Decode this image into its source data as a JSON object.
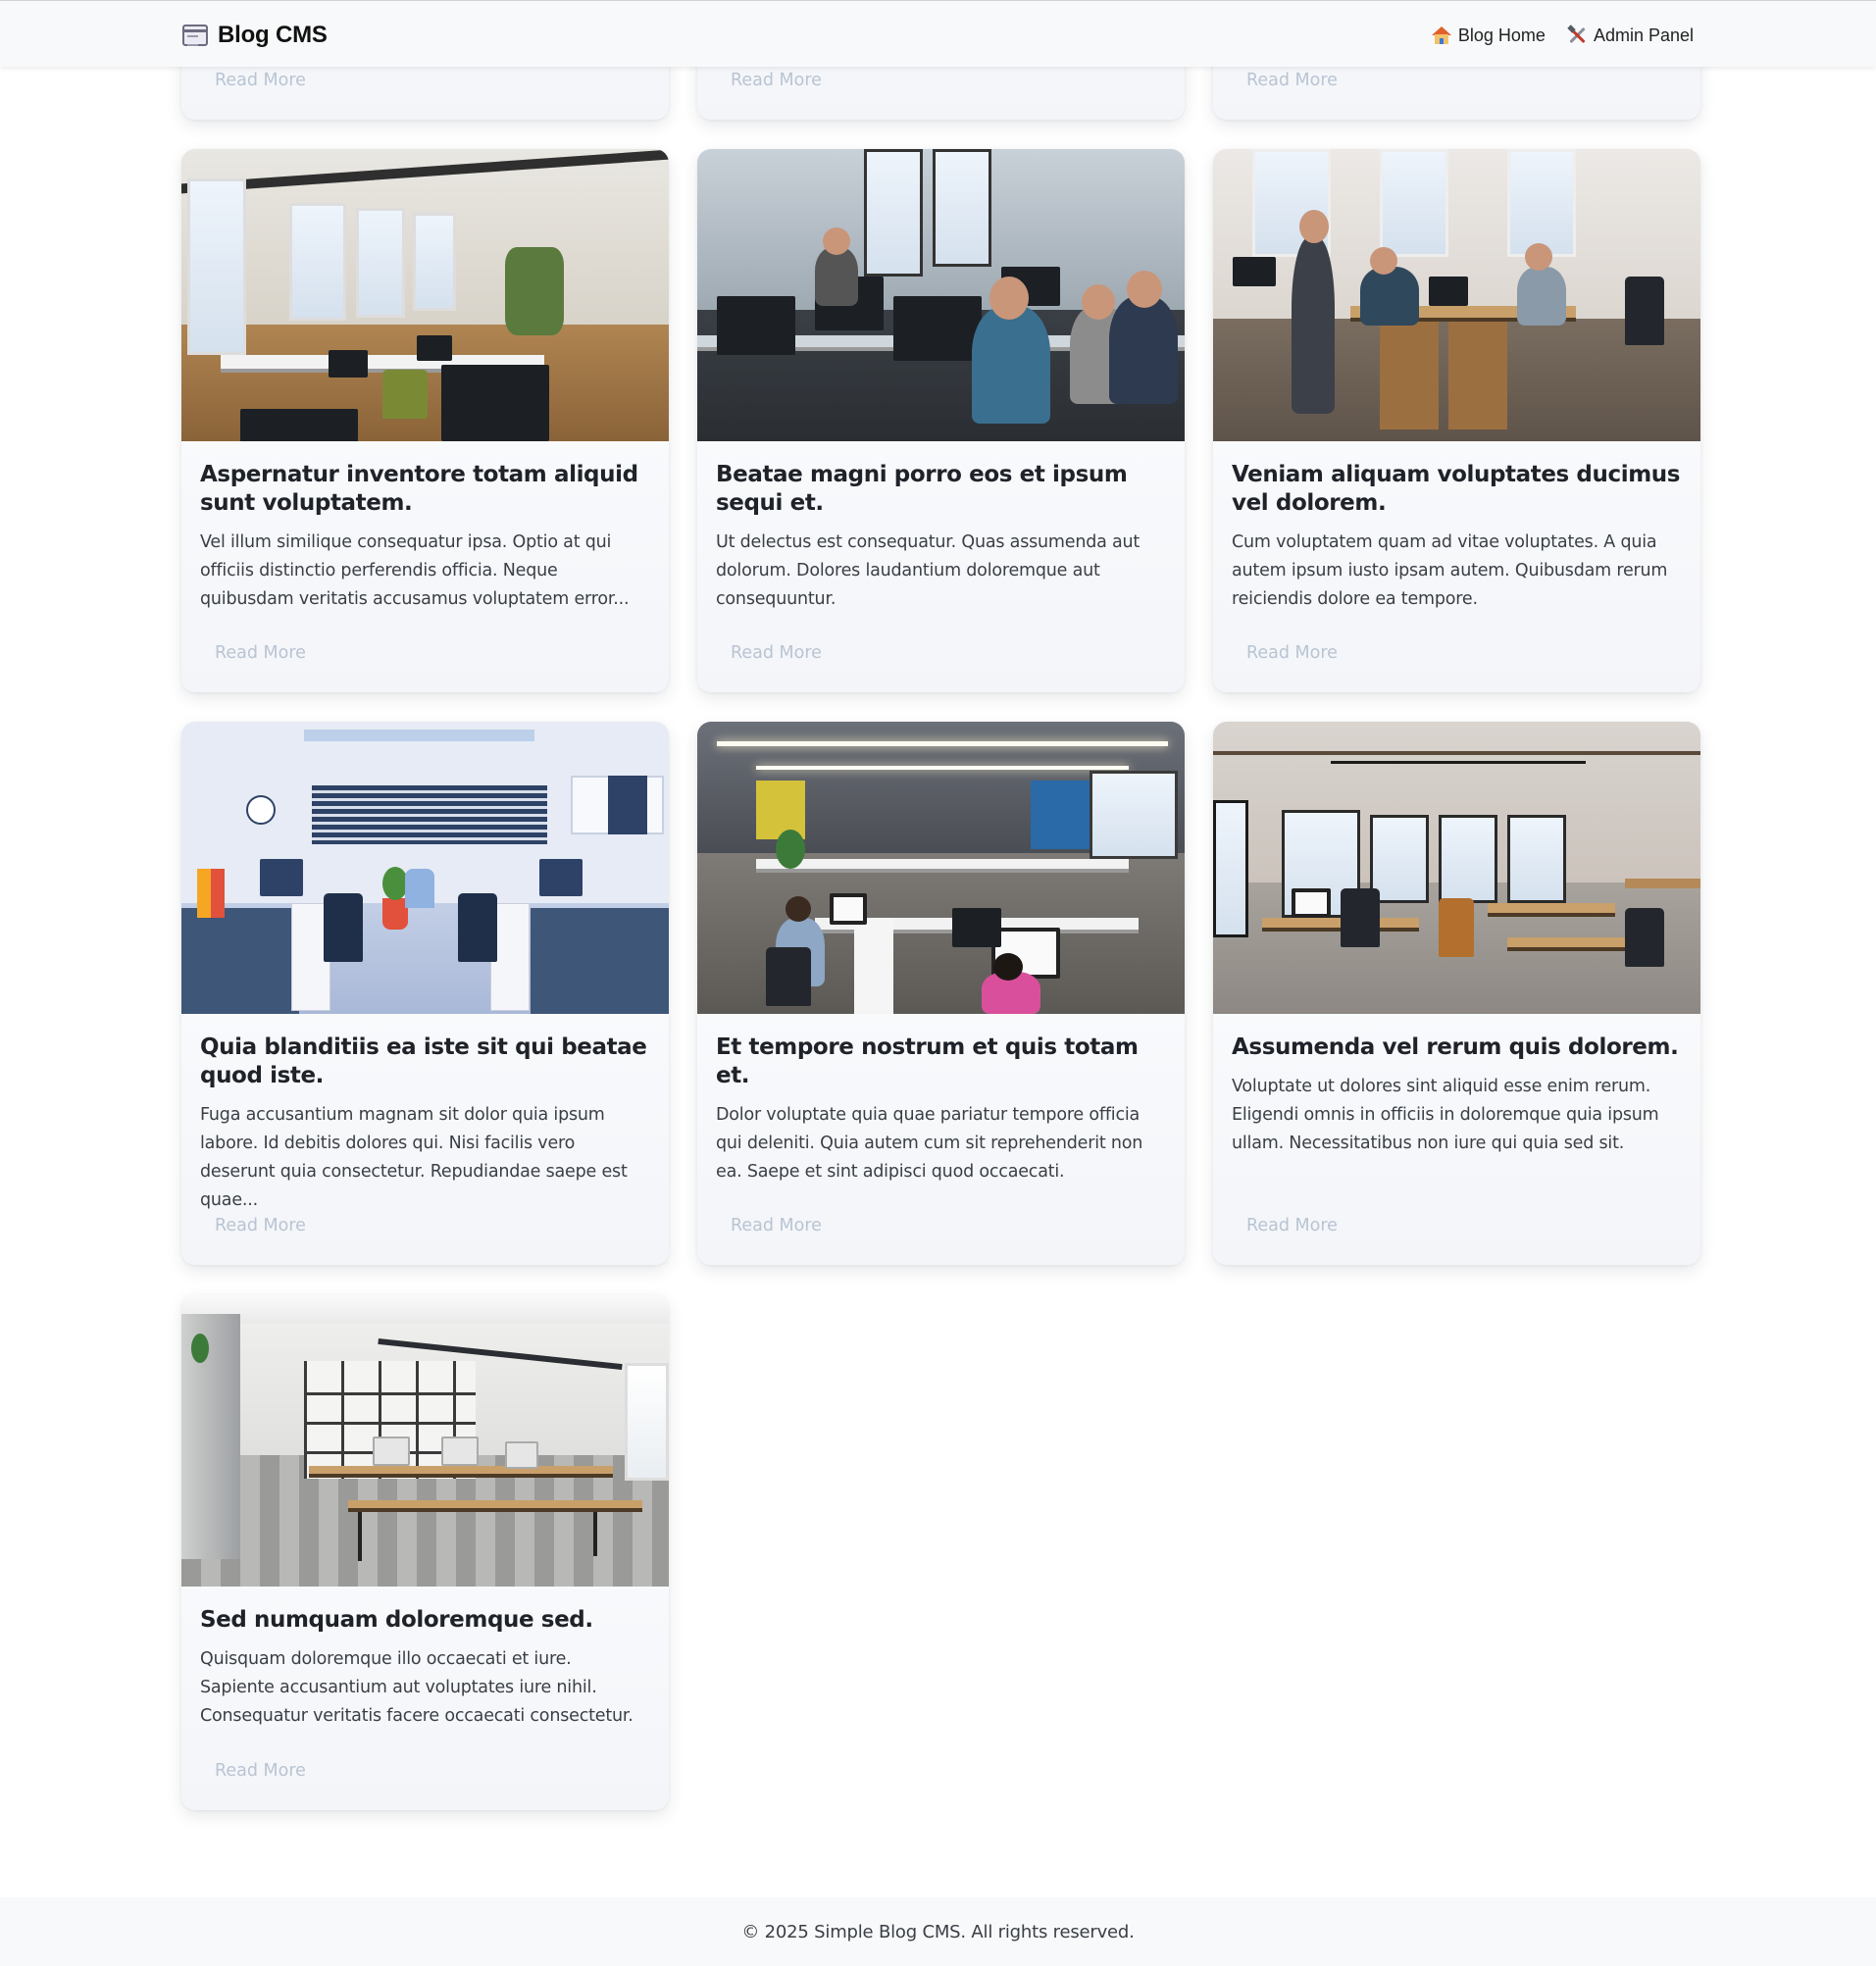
{
  "navbar": {
    "brand": "Blog CMS",
    "brand_icon": "newspaper-icon",
    "links": [
      {
        "label": "Blog Home",
        "icon": "house-icon"
      },
      {
        "label": "Admin Panel",
        "icon": "tools-icon"
      }
    ]
  },
  "top_partial_cards": [
    {
      "read_more": "Read More"
    },
    {
      "read_more": "Read More"
    },
    {
      "read_more": "Read More"
    }
  ],
  "posts": [
    {
      "title": "Aspernatur inventore totam aliquid sunt voluptatem.",
      "excerpt": "Vel illum similique consequatur ipsa. Optio at qui officiis distinctio perferendis officia. Neque quibusdam veritatis accusamus voluptatem error...",
      "read_more": "Read More",
      "image": "bright office with windows"
    },
    {
      "title": "Beatae magni porro eos et ipsum sequi et.",
      "excerpt": "Ut delectus est consequatur. Quas assumenda aut dolorum. Dolores laudantium doloremque aut consequuntur.",
      "read_more": "Read More",
      "image": "team working at computers"
    },
    {
      "title": "Veniam aliquam voluptates ducimus vel dolorem.",
      "excerpt": "Cum voluptatem quam ad vitae voluptates. A quia autem ipsum iusto ipsam autem. Quibusdam rerum reiciendis dolore ea tempore.",
      "read_more": "Read More",
      "image": "team meeting at desk"
    },
    {
      "title": "Quia blanditiis ea iste sit qui beatae quod iste.",
      "excerpt": "Fuga accusantium magnam sit dolor quia ipsum labore. Id debitis dolores qui. Nisi facilis vero deserunt quia consectetur. Repudiandae saepe est quae...",
      "read_more": "Read More",
      "image": "illustrated office"
    },
    {
      "title": "Et tempore nostrum et quis totam et.",
      "excerpt": "Dolor voluptate quia quae pariatur tempore officia qui deleniti. Quia autem cum sit reprehenderit non ea. Saepe et sint adipisci quod occaecati.",
      "read_more": "Read More",
      "image": "open plan office"
    },
    {
      "title": "Assumenda vel rerum quis dolorem.",
      "excerpt": "Voluptate ut dolores sint aliquid esse enim rerum. Eligendi omnis in officiis in doloremque quia ipsum ullam. Necessitatibus non iure qui quia sed sit.",
      "read_more": "Read More",
      "image": "industrial office"
    },
    {
      "title": "Sed numquam doloremque sed.",
      "excerpt": "Quisquam doloremque illo occaecati et iure. Sapiente accusantium aut voluptates iure nihil. Consequatur veritatis facere occaecati consectetur.",
      "read_more": "Read More",
      "image": "modern office with shelves"
    }
  ],
  "footer": {
    "text": "© 2025 Simple Blog CMS. All rights reserved."
  }
}
